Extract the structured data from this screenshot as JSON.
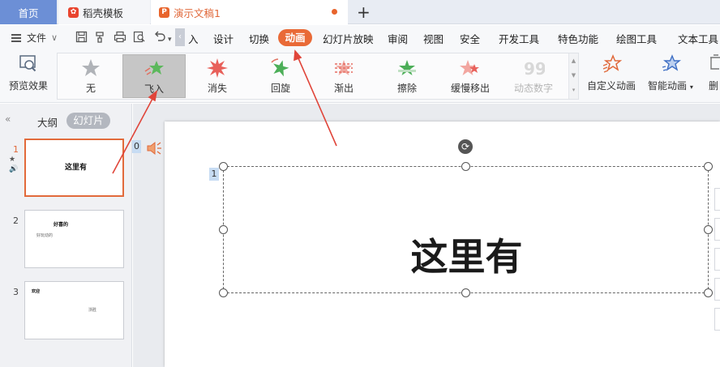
{
  "tabs": {
    "home": "首页",
    "template": "稻壳模板",
    "document": "演示文稿1",
    "add": "+"
  },
  "menubar": {
    "file": "文件",
    "undo_stub": "‹",
    "items": [
      "入",
      "设计",
      "切换",
      "动画",
      "幻灯片放映",
      "审阅",
      "视图",
      "安全",
      "开发工具",
      "特色功能",
      "绘图工具",
      "文本工具"
    ],
    "active": "动画"
  },
  "ribbon": {
    "preview": "预览效果",
    "animations": [
      {
        "label": "无",
        "icon": "star-gray-icon"
      },
      {
        "label": "飞入",
        "icon": "star-fly-in-icon"
      },
      {
        "label": "消失",
        "icon": "star-burst-red-icon"
      },
      {
        "label": "回旋",
        "icon": "star-spin-green-icon"
      },
      {
        "label": "渐出",
        "icon": "star-fade-out-icon"
      },
      {
        "label": "擦除",
        "icon": "star-wipe-green-icon"
      },
      {
        "label": "缓慢移出",
        "icon": "star-slow-out-icon"
      },
      {
        "label": "动态数字",
        "icon": "dynamic-number-icon"
      }
    ],
    "selected": "飞入",
    "custom": "自定义动画",
    "smart": "智能动画",
    "delete_partial": "删"
  },
  "panel": {
    "outline": "大纲",
    "slides": "幻灯片",
    "thumbs": [
      {
        "num": "1",
        "title": "这里有",
        "sub": ""
      },
      {
        "num": "2",
        "title": "好喜的",
        "sub": "好玩动的"
      },
      {
        "num": "3",
        "title": "欢迎",
        "sub": "浙胜"
      }
    ]
  },
  "slide": {
    "anim_order": "0",
    "textbox_order": "1",
    "text": "这里有"
  },
  "colors": {
    "accent": "#e96a37",
    "home_tab": "#6c8fd6",
    "annotation": "#e0453a"
  }
}
